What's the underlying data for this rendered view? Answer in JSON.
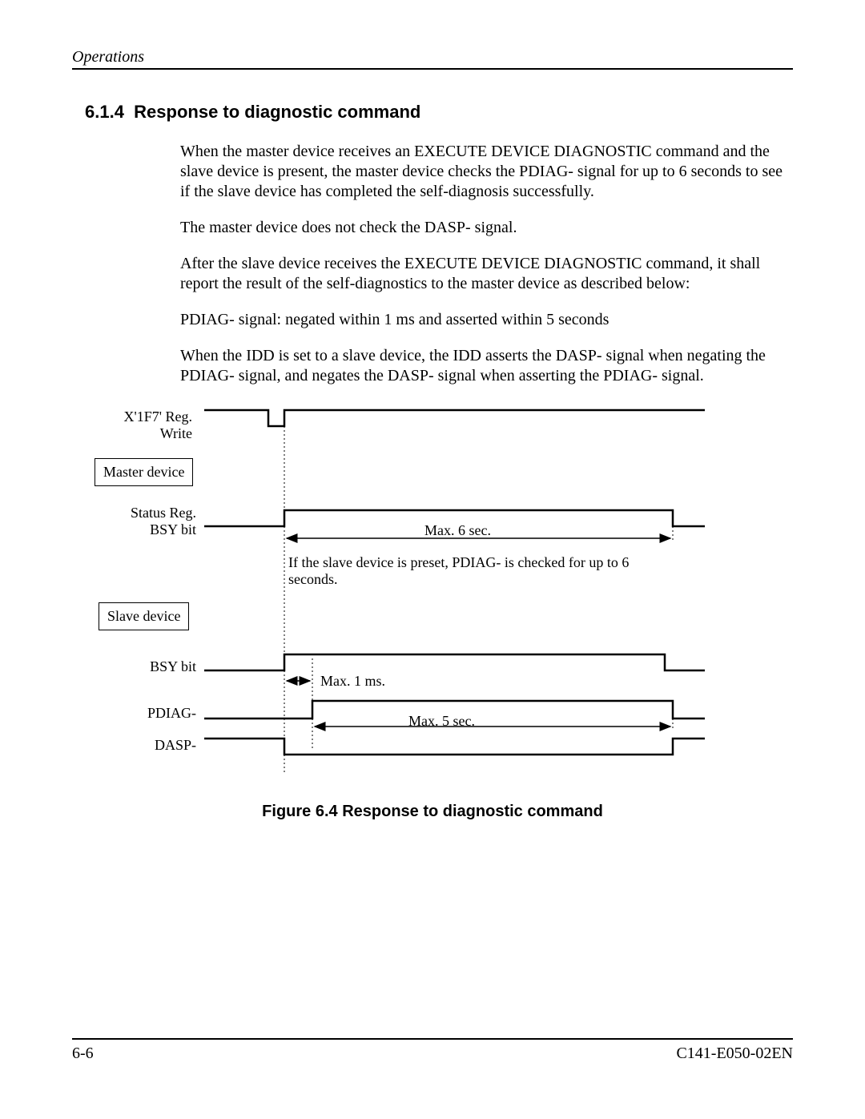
{
  "header": "Operations",
  "section_number": "6.1.4",
  "section_title": "Response to diagnostic command",
  "para1": "When the master device receives an EXECUTE DEVICE DIAGNOSTIC command and the slave device is present, the master device checks the PDIAG- signal for up to 6 seconds to see if the slave device has completed the self-diagnosis successfully.",
  "para2": "The master device does not check the DASP- signal.",
  "para3": "After the slave device receives the EXECUTE DEVICE DIAGNOSTIC command, it shall report the result of the self-diagnostics to the master device as described below:",
  "para4": "PDIAG- signal:  negated within 1 ms and asserted within 5 seconds",
  "para5": "When the IDD is set to a slave device, the IDD asserts the DASP- signal when negating the PDIAG- signal, and negates the DASP- signal when asserting the PDIAG- signal.",
  "diagram": {
    "signal1_line1": "X'1F7' Reg.",
    "signal1_line2": "Write",
    "box_master": "Master device",
    "signal2_line1": "Status Reg.",
    "signal2_line2": "BSY bit",
    "timing_max6": "Max. 6 sec.",
    "note_pdiag": "If the slave device is preset, PDIAG- is checked for up to 6 seconds.",
    "box_slave": "Slave device",
    "signal3": "BSY bit",
    "timing_max1ms": "Max. 1 ms.",
    "signal4": "PDIAG-",
    "timing_max5": "Max. 5 sec.",
    "signal5": "DASP-"
  },
  "figure_caption": "Figure 6.4  Response to diagnostic command",
  "footer_left": "6-6",
  "footer_right": "C141-E050-02EN",
  "chart_data": {
    "type": "timing-diagram",
    "description": "Signal timing diagram for response to EXECUTE DEVICE DIAGNOSTIC command, showing master and slave device signal behavior.",
    "vertical_guides": [
      "command-write-edge",
      "1ms-after",
      "5/6-sec-edge"
    ],
    "signals": [
      {
        "name": "X'1F7' Reg. Write",
        "device": "master",
        "waveform": "high, short low pulse at command write, then high"
      },
      {
        "name": "Status Reg. BSY bit",
        "device": "master",
        "waveform": "low, goes high at command write, stays high up to Max. 6 sec., then low",
        "timing_label": "Max. 6 sec."
      },
      {
        "name": "BSY bit",
        "device": "slave",
        "waveform": "low, goes high at command write, stays high, then low near end",
        "timing_label": "Max. 1 ms."
      },
      {
        "name": "PDIAG-",
        "device": "slave",
        "waveform": "low, goes high (negated) within 1 ms after command write, stays high up to Max. 5 sec., then low (asserted)",
        "timing_label": "Max. 5 sec."
      },
      {
        "name": "DASP-",
        "device": "slave",
        "waveform": "high until PDIAG- negated, then low (asserted) while PDIAG- is high, then high when PDIAG- asserted"
      }
    ],
    "annotations": [
      "If the slave device is preset, PDIAG- is checked for up to 6 seconds."
    ]
  }
}
